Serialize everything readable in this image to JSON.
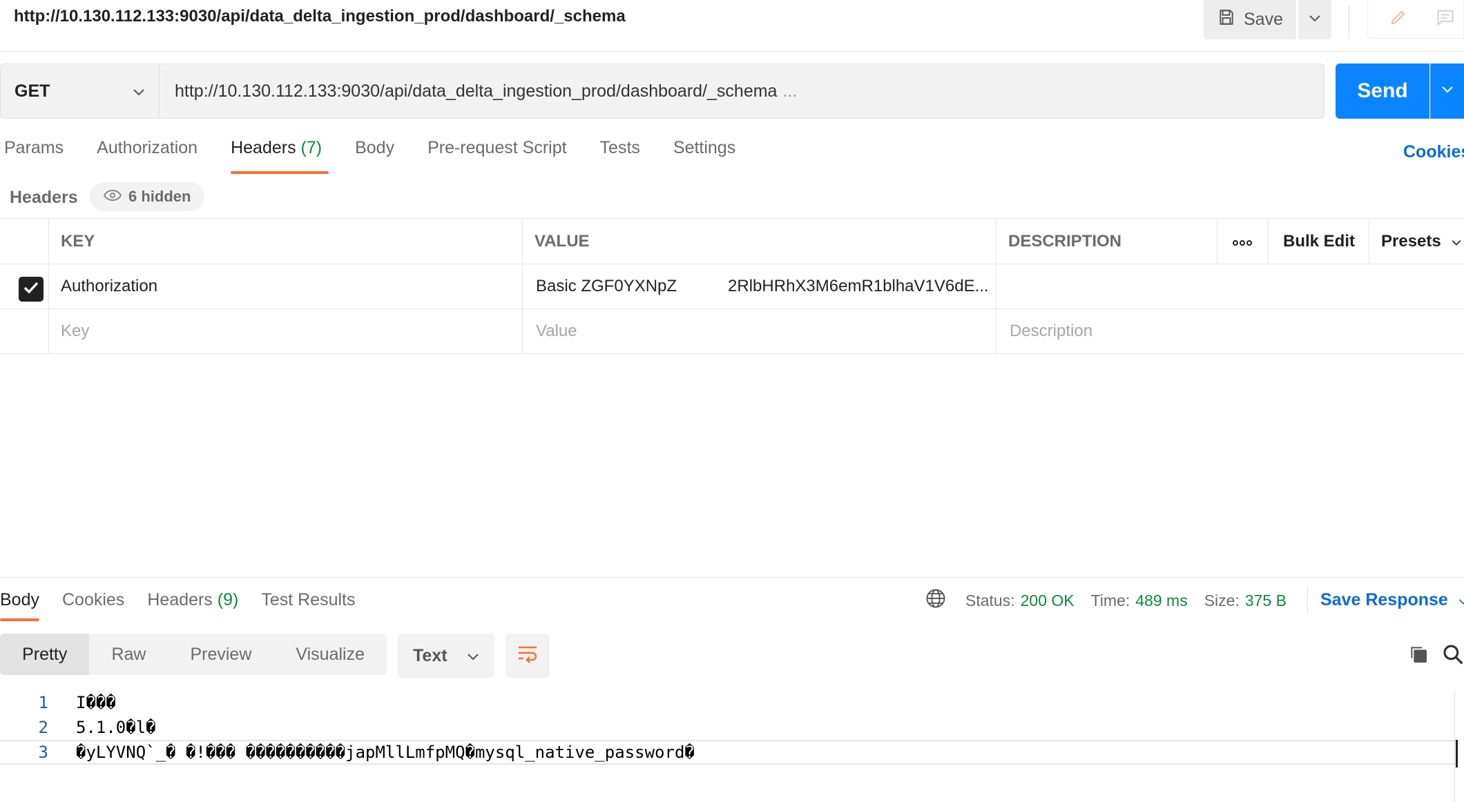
{
  "window": {
    "title": "http://10.130.112.133:9030/api/data_delta_ingestion_prod/dashboard/_schema",
    "save_label": "Save"
  },
  "request": {
    "method": "GET",
    "url": "http://10.130.112.133:9030/api/data_delta_ingestion_prod/dashboard/_schema",
    "url_more": "...",
    "send_label": "Send",
    "tabs": [
      {
        "label": "Params"
      },
      {
        "label": "Authorization"
      },
      {
        "label": "Headers",
        "count": "(7)"
      },
      {
        "label": "Body"
      },
      {
        "label": "Pre-request Script"
      },
      {
        "label": "Tests"
      },
      {
        "label": "Settings"
      }
    ],
    "cookies_label": "Cookies"
  },
  "headers_section": {
    "label": "Headers",
    "hidden_label": "6 hidden",
    "columns": {
      "key": "KEY",
      "value": "VALUE",
      "description": "DESCRIPTION",
      "more": "ooo",
      "bulk_edit": "Bulk Edit",
      "presets": "Presets"
    },
    "rows": [
      {
        "checked": true,
        "key": "Authorization",
        "value": "Basic ZGF0YXNpZ",
        "value_rest": "2RlbHRhX3M6emR1blhaV1V6dE..."
      }
    ],
    "placeholders": {
      "key": "Key",
      "value": "Value",
      "description": "Description"
    }
  },
  "response": {
    "tabs": [
      {
        "label": "Body"
      },
      {
        "label": "Cookies"
      },
      {
        "label": "Headers",
        "count": "(9)"
      },
      {
        "label": "Test Results"
      }
    ],
    "status_label": "Status:",
    "status_value": "200 OK",
    "time_label": "Time:",
    "time_value": "489 ms",
    "size_label": "Size:",
    "size_value": "375 B",
    "save_response_label": "Save Response",
    "views": [
      "Pretty",
      "Raw",
      "Preview",
      "Visualize"
    ],
    "format": "Text",
    "lines": [
      {
        "n": "1",
        "text": "I���"
      },
      {
        "n": "2",
        "text": "5.1.0�l�"
      },
      {
        "n": "3",
        "text": "�yLYVNQ`_� �!��� ����������japMllLmfpMQ�mysql_native_password�"
      }
    ]
  },
  "colors": {
    "accent_orange": "#ff6c37",
    "send_blue": "#0a84ff",
    "link_blue": "#0a6bd4",
    "status_green": "#0c8a3d"
  }
}
